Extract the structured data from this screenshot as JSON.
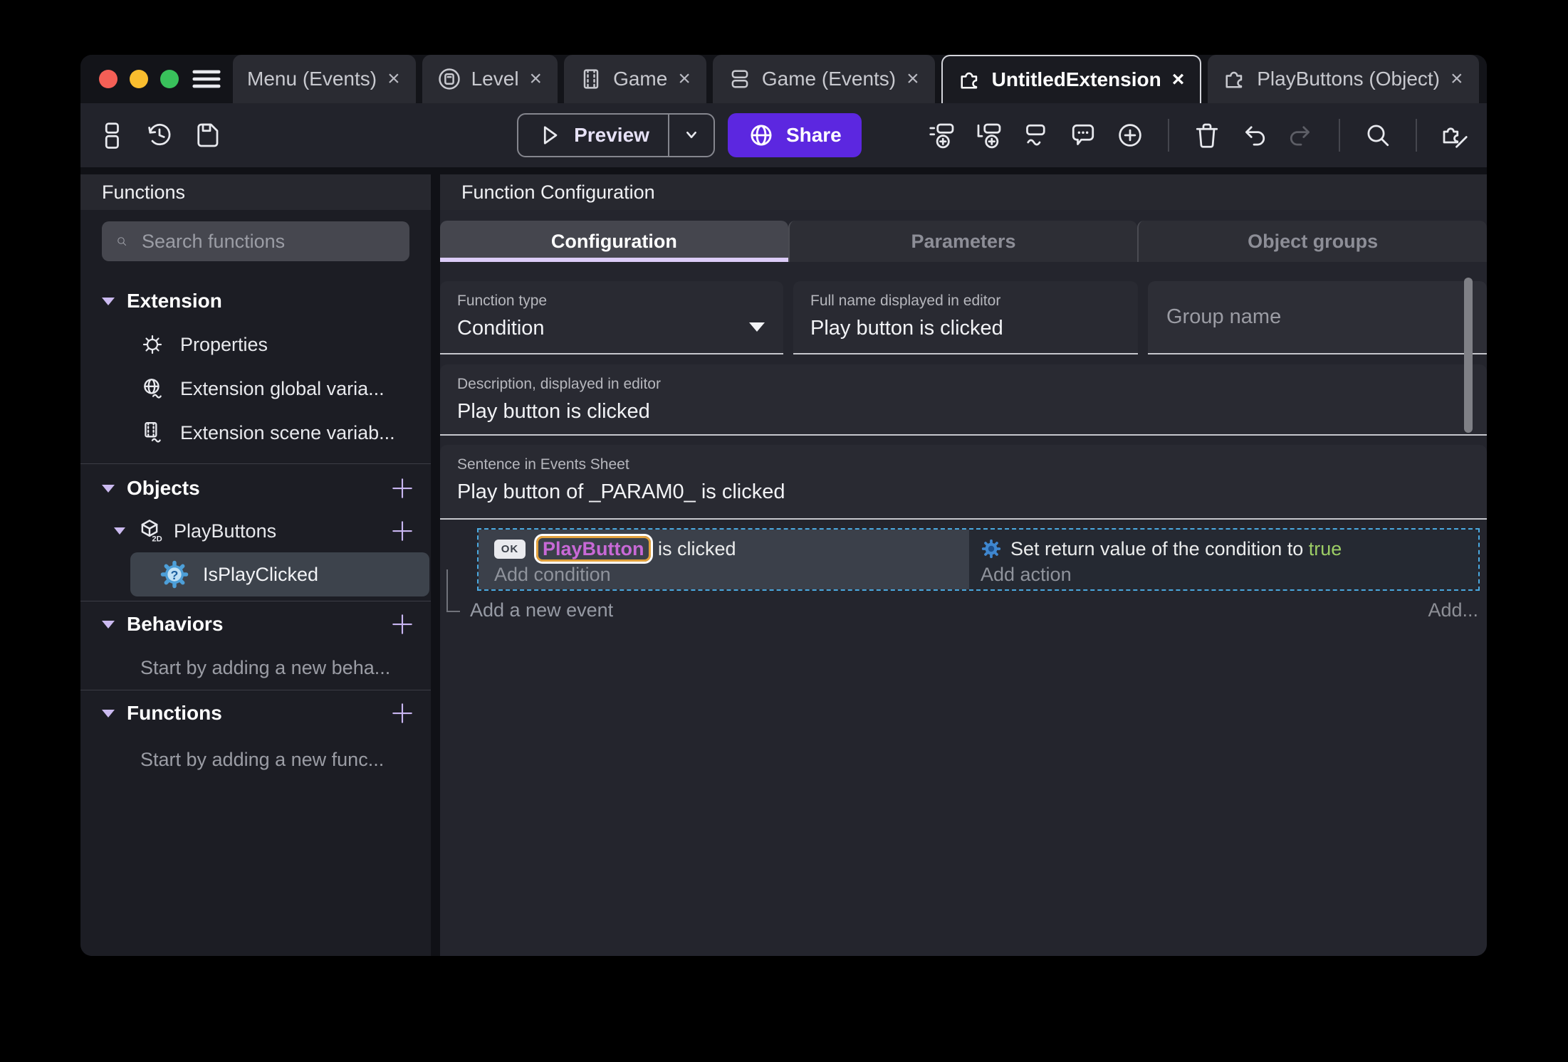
{
  "colors": {
    "accent_purple": "#5c27e0",
    "lavender_accent": "#c9b6f2",
    "tab_underline": "#dcccf8",
    "selection_dashed_blue": "#4aa9e0",
    "object_highlight_text": "#c869d6",
    "object_highlight_border": "#e2a13c",
    "true_green": "#9ccd65",
    "traffic_red": "#f45f56",
    "traffic_yellow": "#f9bd2e",
    "traffic_green": "#39c15b"
  },
  "tabbar": {
    "close_glyph": "×",
    "tabs": [
      {
        "label": "Menu (Events)"
      },
      {
        "label": "Level"
      },
      {
        "label": "Game"
      },
      {
        "label": "Game (Events)"
      },
      {
        "label": "UntitledExtension"
      },
      {
        "label": "PlayButtons (Object)"
      }
    ]
  },
  "toolbar": {
    "preview_label": "Preview",
    "share_label": "Share"
  },
  "sidebar": {
    "title": "Functions",
    "search_placeholder": "Search functions",
    "extension": {
      "label": "Extension",
      "items": [
        {
          "label": "Properties"
        },
        {
          "label": "Extension global varia..."
        },
        {
          "label": "Extension scene variab..."
        }
      ]
    },
    "objects": {
      "label": "Objects",
      "group": "PlayButtons",
      "selected": "IsPlayClicked"
    },
    "behaviors": {
      "label": "Behaviors",
      "empty": "Start by adding a new beha..."
    },
    "functions": {
      "label": "Functions",
      "empty": "Start by adding a new func..."
    }
  },
  "main": {
    "title": "Function Configuration",
    "tabs": [
      {
        "label": "Configuration"
      },
      {
        "label": "Parameters"
      },
      {
        "label": "Object groups"
      }
    ],
    "function_type": {
      "label": "Function type",
      "value": "Condition"
    },
    "full_name": {
      "label": "Full name displayed in editor",
      "value": "Play button is clicked"
    },
    "group_name": {
      "placeholder": "Group name"
    },
    "description": {
      "label": "Description, displayed in editor",
      "value": "Play button is clicked"
    },
    "sentence": {
      "label": "Sentence in Events Sheet",
      "value": "Play button of _PARAM0_ is clicked"
    },
    "events": {
      "condition_badge": "OK",
      "condition_object": "PlayButton",
      "condition_text": "is clicked",
      "add_condition": "Add condition",
      "action_text": "Set return value of the condition to",
      "action_value": "true",
      "add_action": "Add action",
      "add_event": "Add a new event",
      "add_more": "Add..."
    }
  }
}
